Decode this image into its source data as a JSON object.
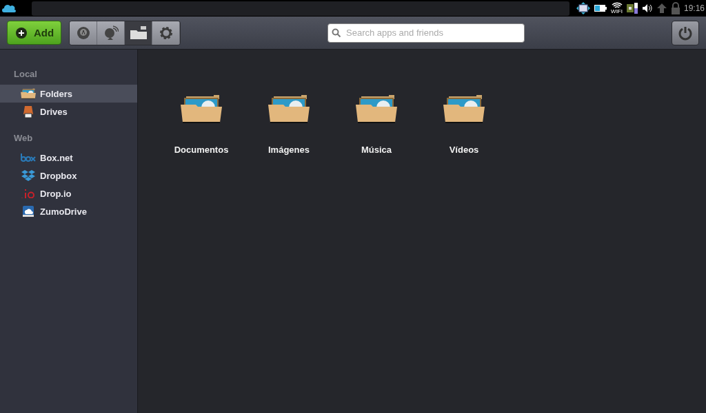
{
  "status_bar": {
    "wifi_label": "WIFI",
    "clock": "19:16"
  },
  "toolbar": {
    "add_button": "Add",
    "mode_buttons": [
      {
        "kind": "apps",
        "selected": false
      },
      {
        "kind": "radar",
        "selected": false
      },
      {
        "kind": "files",
        "selected": true
      },
      {
        "kind": "settings",
        "selected": false
      }
    ],
    "search": {
      "placeholder": "Search apps and friends"
    }
  },
  "sidebar": {
    "sections": [
      {
        "title": "Local",
        "items": [
          {
            "label": "Folders",
            "kind": "folder",
            "selected": true
          },
          {
            "label": "Drives",
            "kind": "drive",
            "selected": false
          }
        ]
      },
      {
        "title": "Web",
        "items": [
          {
            "label": "Box.net",
            "kind": "box",
            "selected": false
          },
          {
            "label": "Dropbox",
            "kind": "dropbox",
            "selected": false
          },
          {
            "label": "Drop.io",
            "kind": "dropio",
            "selected": false
          },
          {
            "label": "ZumoDrive",
            "kind": "zumo",
            "selected": false
          }
        ]
      }
    ]
  },
  "folders": [
    {
      "label": "Documentos"
    },
    {
      "label": "Imágenes"
    },
    {
      "label": "Música"
    },
    {
      "label": "Vídeos"
    }
  ]
}
